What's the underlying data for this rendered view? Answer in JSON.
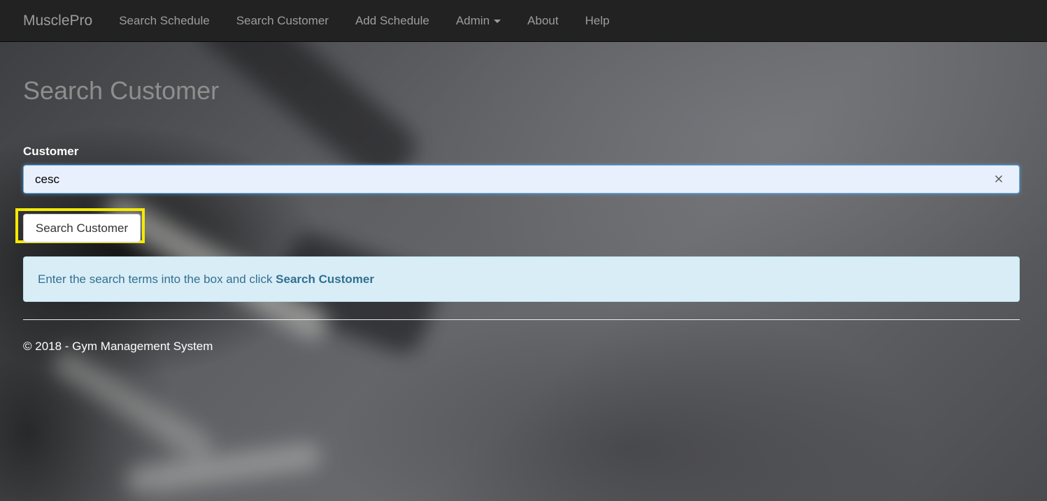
{
  "navbar": {
    "brand": "MusclePro",
    "items": [
      {
        "label": "Search Schedule"
      },
      {
        "label": "Search Customer"
      },
      {
        "label": "Add Schedule"
      },
      {
        "label": "Admin",
        "has_dropdown": true
      },
      {
        "label": "About"
      },
      {
        "label": "Help"
      }
    ]
  },
  "main": {
    "title": "Search Customer",
    "customer_field": {
      "label": "Customer",
      "value": "cesc",
      "clear_icon": "close-icon"
    },
    "search_button": {
      "label": "Search Customer",
      "highlight_color": "#f5ea00"
    },
    "info_alert": {
      "text": "Enter the search terms into the box and click ",
      "emphasis": "Search Customer"
    }
  },
  "footer": {
    "text": "© 2018 - Gym Management System"
  },
  "colors": {
    "navbar_bg": "#222222",
    "nav_text": "#9d9d9d",
    "alert_bg": "#d9edf7",
    "alert_text": "#31708f",
    "input_bg": "#e8f0fe"
  }
}
